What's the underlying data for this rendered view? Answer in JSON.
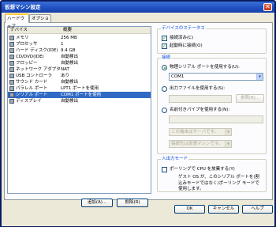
{
  "window": {
    "title": "仮想マシン設定",
    "close_glyph": "✕"
  },
  "tabs": [
    {
      "label": "ハードウェア"
    },
    {
      "label": "オプション"
    }
  ],
  "device_list": {
    "columns": [
      "デバイス",
      "概要"
    ],
    "rows": [
      {
        "name": "メモリ",
        "summary": "256 MB",
        "icon": "memory-icon"
      },
      {
        "name": "プロセッサ",
        "summary": "1",
        "icon": "processor-icon"
      },
      {
        "name": "ハード ディスク(IDE)",
        "summary": "9.4 GB",
        "icon": "hard-disk-icon"
      },
      {
        "name": "CD/DVD(IDE)",
        "summary": "自動検出",
        "icon": "cd-dvd-icon"
      },
      {
        "name": "フロッピー",
        "summary": "自動検出",
        "icon": "floppy-icon"
      },
      {
        "name": "ネットワーク アダプタ",
        "summary": "NAT",
        "icon": "network-icon"
      },
      {
        "name": "USB コントローラ",
        "summary": "あり",
        "icon": "usb-icon"
      },
      {
        "name": "サウンド カード",
        "summary": "自動検出",
        "icon": "sound-icon"
      },
      {
        "name": "パラレル ポート",
        "summary": "LPT1 ポートを使用",
        "icon": "parallel-port-icon"
      },
      {
        "name": "シリアル ポート",
        "summary": "COM1 ポートを使用",
        "icon": "serial-port-icon",
        "selected": true
      },
      {
        "name": "ディスプレイ",
        "summary": "自動検出",
        "icon": "display-icon"
      }
    ],
    "add_label": "追加(A)...",
    "remove_label": "削除(R)"
  },
  "device_status": {
    "title": "デバイスのステータス",
    "connected_label": "接続済み(C)",
    "connect_at_power_on_label": "起動時に接続(O)",
    "check_glyph": "✓"
  },
  "connection": {
    "title": "接続",
    "physical_label": "物理シリアル ポートを使用する(U):",
    "physical_value": "COM1",
    "output_file_label": "出力ファイルを使用する(S):",
    "browse_label": "参照(B)...",
    "named_pipe_label": "名前付きパイプを使用する(N):",
    "pipe_end_value": "この端末はサーバです。",
    "pipe_other_value": "接続先は仮想マシンです。",
    "dropdown_glyph": "▼"
  },
  "io_mode": {
    "title": "入出力モード",
    "yield_label": "ポーリングで CPU を放棄する(Y)",
    "description": "ゲスト OS が、このシリアル ポートを(割込みモードではなく)ポーリング モードで使用します。"
  },
  "footer": {
    "ok_label": "OK",
    "cancel_label": "キャンセル",
    "help_label": "ヘルプ"
  }
}
